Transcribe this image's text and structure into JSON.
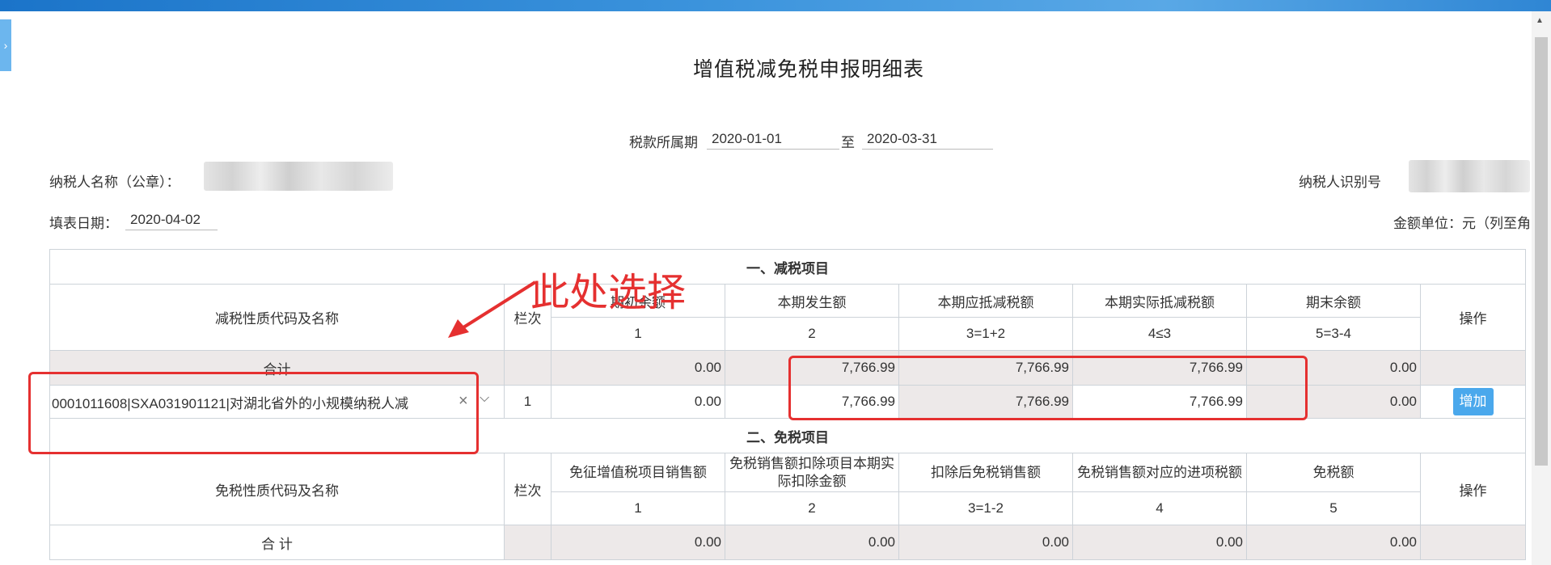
{
  "form": {
    "title": "增值税减免税申报明细表",
    "period_label": "税款所属期",
    "period_start": "2020-01-01",
    "period_to": "至",
    "period_end": "2020-03-31",
    "taxpayer_name_label": "纳税人名称（公章）：",
    "taxpayer_id_label": "纳税人识别号",
    "fill_date_label": "填表日期：",
    "fill_date": "2020-04-02",
    "unit_label": "金额单位：元（列至角"
  },
  "reduction": {
    "section_title": "一、减税项目",
    "col_name": "减税性质代码及名称",
    "col_row": "栏次",
    "col_begin": "期初余额",
    "col_current": "本期发生额",
    "col_deductible": "本期应抵减税额",
    "col_actual": "本期实际抵减税额",
    "col_end": "期末余额",
    "col_op": "操作",
    "idx_begin": "1",
    "idx_current": "2",
    "idx_deductible": "3=1+2",
    "idx_actual": "4≤3",
    "idx_end": "5=3-4",
    "total_label": "合计",
    "total_begin": "0.00",
    "total_current": "7,766.99",
    "total_deductible": "7,766.99",
    "total_actual": "7,766.99",
    "total_end": "0.00",
    "row_select_value": "0001011608|SXA031901121|对湖北省外的小规模纳税人减",
    "row_num": "1",
    "row_begin": "0.00",
    "row_current": "7,766.99",
    "row_deductible": "7,766.99",
    "row_actual": "7,766.99",
    "row_end": "0.00",
    "add_button": "增加",
    "clear_icon": "×",
    "dropdown_icon": "⌵"
  },
  "exemption": {
    "section_title": "二、免税项目",
    "col_name": "免税性质代码及名称",
    "col_row": "栏次",
    "col_sales": "免征增值税项目销售额",
    "col_deduct": "免税销售额扣除项目本期实际扣除金额",
    "col_after": "扣除后免税销售额",
    "col_input": "免税销售额对应的进项税额",
    "col_amount": "免税额",
    "col_op": "操作",
    "idx_sales": "1",
    "idx_deduct": "2",
    "idx_after": "3=1-2",
    "idx_input": "4",
    "idx_amount": "5",
    "total_label": "合  计",
    "total_sales": "0.00",
    "total_deduct": "0.00",
    "total_after": "0.00",
    "total_input": "0.00",
    "total_amount": "0.00"
  },
  "annotation": {
    "text": "此处选择",
    "color": "#e53030"
  }
}
